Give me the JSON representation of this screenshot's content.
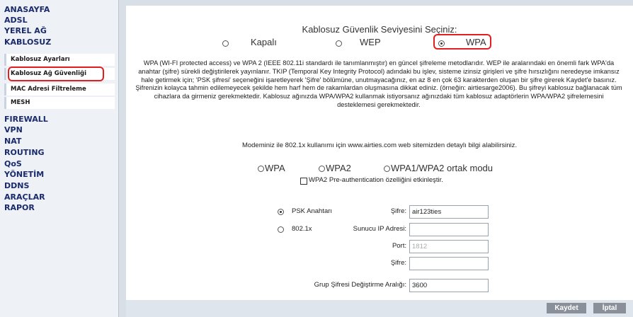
{
  "sidebar": {
    "menu": [
      "ANASAYFA",
      "ADSL",
      "YEREL AĞ",
      "KABLOSUZ"
    ],
    "sub": [
      "Kablosuz Ayarları",
      "Kablosuz Ağ Güvenliği",
      "MAC Adresi Filtreleme",
      "MESH"
    ],
    "menu2": [
      "FIREWALL",
      "VPN",
      "NAT",
      "ROUTING",
      "QoS",
      "YÖNETİM",
      "DDNS",
      "ARAÇLAR",
      "RAPOR"
    ]
  },
  "main": {
    "title": "Kablosuz Güvenlik Seviyesini Seçiniz:",
    "levels": [
      "Kapalı",
      "WEP",
      "WPA"
    ],
    "selected_level": "WPA",
    "description": "WPA (WI-FI protected access) ve WPA 2 (IEEE 802.11i standardı ile tanımlanmıştır) en güncel şifreleme metodlarıdır. WEP ile aralarındaki en önemli fark WPA'da anahtar (şifre) sürekli değiştirilerek yayınlanır. TKIP (Temporal Key Integrity Protocol) adındaki bu işlev, sisteme izinsiz girişleri ve şifre hırsızlığını neredeyse imkansız hale getirmek için; 'PSK şifresi' seçeneğini işaretleyerek 'Şifre' bölümüne, unutmayacağınız, en az 8 en çok 63 karakterden oluşan bir şifre girerek Kaydet'e basınız. Şifrenizin kolayca tahmin edilemeyecek şekilde hem harf hem de rakamlardan oluşmasına dikkat ediniz. (örneğin: airtiesarge2006). Bu şifreyi kablosuz bağlanacak tüm cihazlara da girmeniz gerekmektedir. Kablosuz ağınızda WPA/WPA2 kullanmak istiyorsanız ağınızdaki tüm kablosuz adaptörlerin WPA/WPA2 şifrelemesini desteklemesi gerekmektedir.",
    "info": "Modeminiz ile 802.1x kullanımı için www.airties.com web sitemizden detaylı bilgi alabilirsiniz.",
    "modes": [
      "WPA",
      "WPA2",
      "WPA1/WPA2 ortak modu"
    ],
    "preauth_label": "WPA2 Pre-authentication özelliğini etkinleştir.",
    "psk_label": "PSK Anahtarı",
    "dot1x_label": "802.1x",
    "password_label": "Şifre:",
    "password_value": "air123ties",
    "server_ip_label": "Sunucu IP Adresi:",
    "port_label": "Port:",
    "port_value": "1812",
    "password2_label": "Şifre:",
    "group_label": "Grup Şifresi Değiştirme Aralığı:",
    "group_value": "3600"
  },
  "buttons": {
    "save": "Kaydet",
    "cancel": "İptal"
  },
  "colors": {
    "accent_red": "#e02020",
    "menu_text": "#1a2a6c",
    "button_bg": "#8a8f99"
  }
}
